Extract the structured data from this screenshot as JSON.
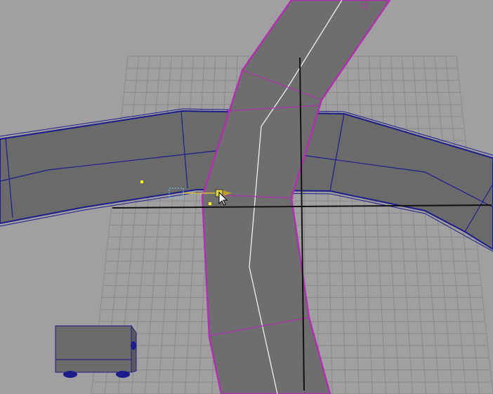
{
  "viewport": {
    "background": "#a0a0a0",
    "grid_color": "#8a8a8a",
    "axis_color": "#111111"
  },
  "colors": {
    "road_fill": "#6a6a6a",
    "road_fill_selected": "#6e6e6e",
    "horizontal_road_outline": "#1c1c8a",
    "vertical_road_outline": "#b030b0",
    "vertical_road_spine": "#f0f0f0",
    "truck_body": "#6b6b6b",
    "truck_wheels": "#1c1c8a",
    "marker": "#ffff00",
    "cursor": "#ffffff"
  },
  "icons": {
    "manipulator": "move-manipulator-icon",
    "cursor": "mouse-pointer-icon",
    "truck": "truck-model-icon"
  }
}
